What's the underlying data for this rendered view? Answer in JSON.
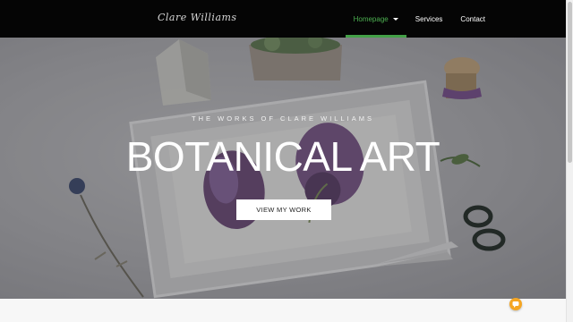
{
  "header": {
    "logo_text": "Clare Williams",
    "nav": [
      {
        "label": "Homepage",
        "active": true,
        "has_dropdown": true
      },
      {
        "label": "Services",
        "active": false
      },
      {
        "label": "Contact",
        "active": false
      }
    ]
  },
  "hero": {
    "subtitle": "THE WORKS OF CLARE WILLIAMS",
    "title": "BOTANICAL ART",
    "cta_label": "VIEW MY WORK"
  },
  "colors": {
    "header_bg": "#050505",
    "accent_green": "#43a047",
    "chat_orange": "#f5a623"
  },
  "icons": {
    "nav_dropdown": "caret-down-icon",
    "chat": "chat-bubble-icon"
  }
}
